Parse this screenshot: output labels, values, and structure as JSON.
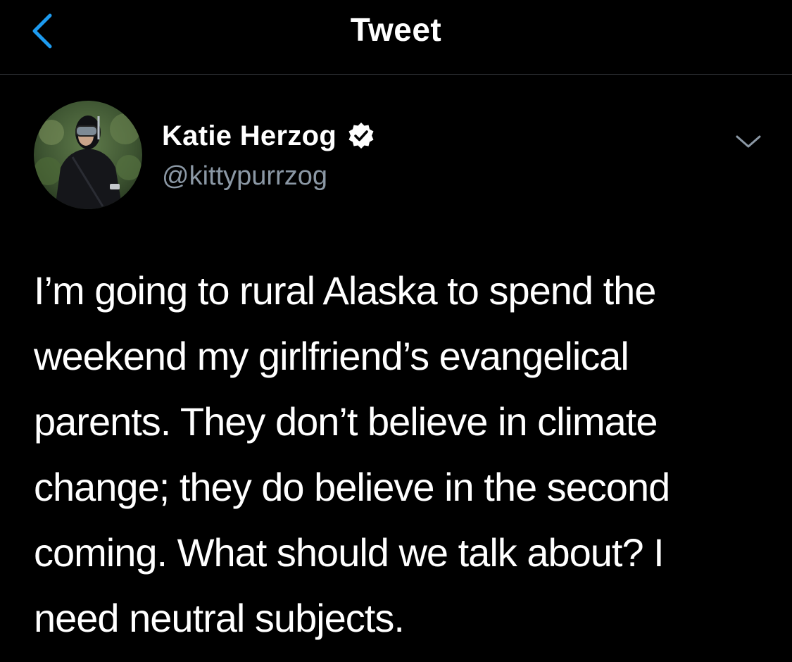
{
  "nav": {
    "title": "Tweet",
    "back_icon": "chevron-left-icon"
  },
  "author": {
    "name": "Katie Herzog",
    "handle": "@kittypurrzog",
    "verified": true,
    "verified_icon": "verified-badge-icon",
    "more_icon": "chevron-down-icon"
  },
  "tweet": {
    "text": "I’m going to rural Alaska to spend the\nweekend my girlfriend’s evangelical\nparents. They don’t believe in climate\nchange; they do believe in the second\ncoming. What should we talk about? I\nneed neutral subjects."
  },
  "colors": {
    "background": "#000000",
    "text_primary": "#ffffff",
    "text_secondary": "#8b98a5",
    "accent": "#1d9bf0",
    "divider": "#2f3336"
  }
}
